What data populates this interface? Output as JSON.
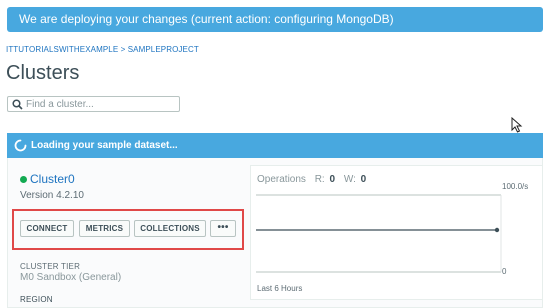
{
  "banner": {
    "text": "We are deploying your changes (current action: configuring MongoDB)"
  },
  "breadcrumb": {
    "org": "ITTUTORIALSWITHEXAMPLE",
    "separator": ">",
    "project": "SAMPLEPROJECT"
  },
  "page": {
    "title": "Clusters"
  },
  "search": {
    "placeholder": "Find a cluster..."
  },
  "loading": {
    "text": "Loading your sample dataset..."
  },
  "cluster": {
    "name": "Cluster0",
    "version": "Version 4.2.10",
    "status_color": "#13aa52",
    "buttons": {
      "connect": "CONNECT",
      "metrics": "METRICS",
      "collections": "COLLECTIONS",
      "more": "•••"
    },
    "tier_label": "CLUSTER TIER",
    "tier_value": "M0 Sandbox (General)",
    "region_label": "REGION"
  },
  "metrics": {
    "title": "Operations",
    "r_label": "R:",
    "r_value": "0",
    "w_label": "W:",
    "w_value": "0",
    "max_label": "100.0/s",
    "zero_label": "0",
    "range_label": "Last 6 Hours"
  },
  "colors": {
    "banner": "#48a8df",
    "link": "#1e74c0",
    "highlight": "#e04848"
  }
}
